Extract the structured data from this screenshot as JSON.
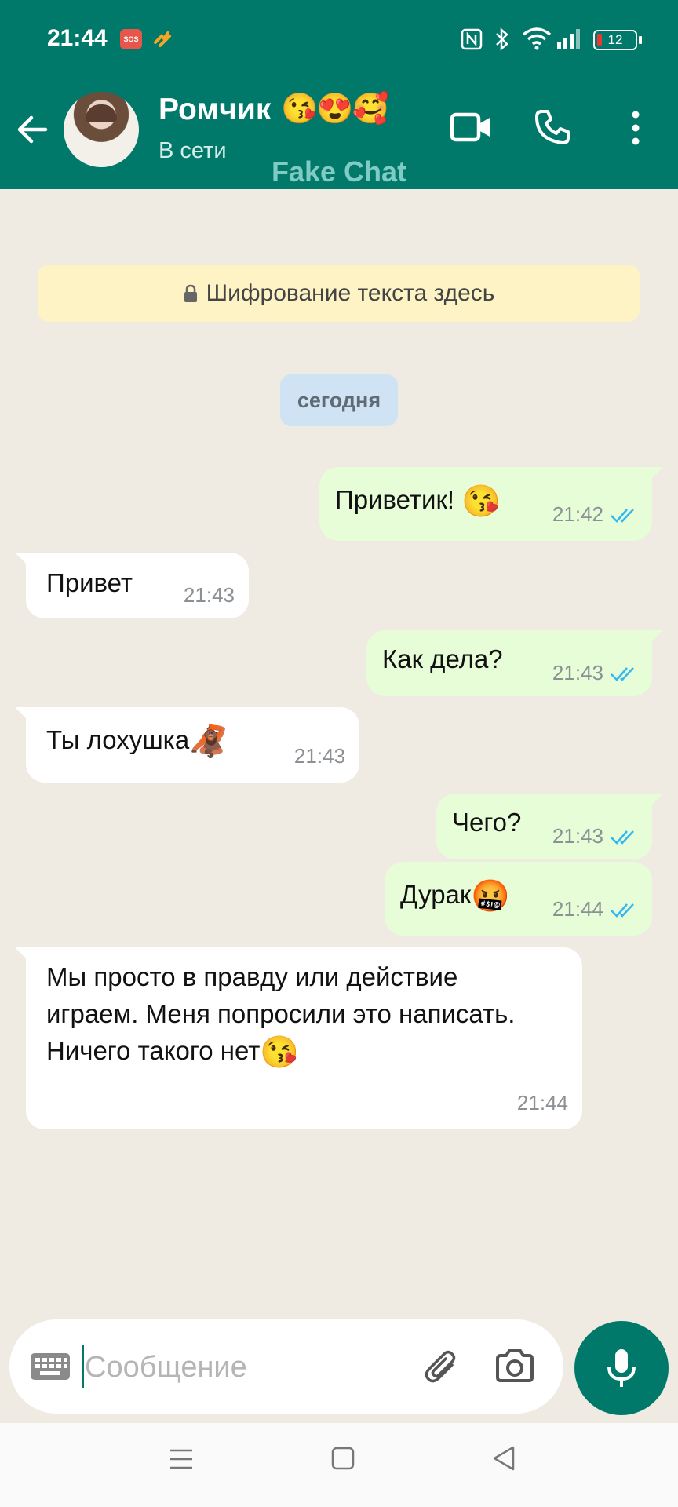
{
  "status_bar": {
    "time": "21:44",
    "sos_label": "SOS",
    "battery": "12"
  },
  "header": {
    "contact_name": "Ромчик",
    "name_emojis": "😘😍🥰",
    "presence": "В сети",
    "watermark": "Fake Chat",
    "icons": [
      "arrow-back-icon",
      "video-call-icon",
      "phone-call-icon",
      "more-vert-icon"
    ]
  },
  "chat": {
    "encryption_notice": "Шифрование текста здесь",
    "date_chip": "сегодня",
    "messages": [
      {
        "direction": "out",
        "text": "Приветик! ",
        "emoji": "😘",
        "time": "21:42",
        "status": "read"
      },
      {
        "direction": "in",
        "text": "Привет",
        "emoji": "",
        "time": "21:43"
      },
      {
        "direction": "out",
        "text": "Как дела?",
        "emoji": "",
        "time": "21:43",
        "status": "read"
      },
      {
        "direction": "in",
        "text": "Ты лохушка",
        "emoji": "🦧",
        "time": "21:43"
      },
      {
        "direction": "out",
        "text": "Чего?",
        "emoji": "",
        "time": "21:43",
        "status": "read"
      },
      {
        "direction": "out",
        "text": "Дурак",
        "emoji": "🤬",
        "time": "21:44",
        "status": "read"
      },
      {
        "direction": "in",
        "text": "Мы просто в правду или действие играем. Меня попросили это написать. Ничего такого нет",
        "emoji": "😘",
        "time": "21:44"
      }
    ]
  },
  "composer": {
    "placeholder": "Сообщение",
    "value": ""
  },
  "colors": {
    "header": "#00796b",
    "outgoing_bubble": "#e7fdd8",
    "incoming_bubble": "#ffffff",
    "chat_background": "#efeae2",
    "read_ticks": "#34b7f1"
  }
}
